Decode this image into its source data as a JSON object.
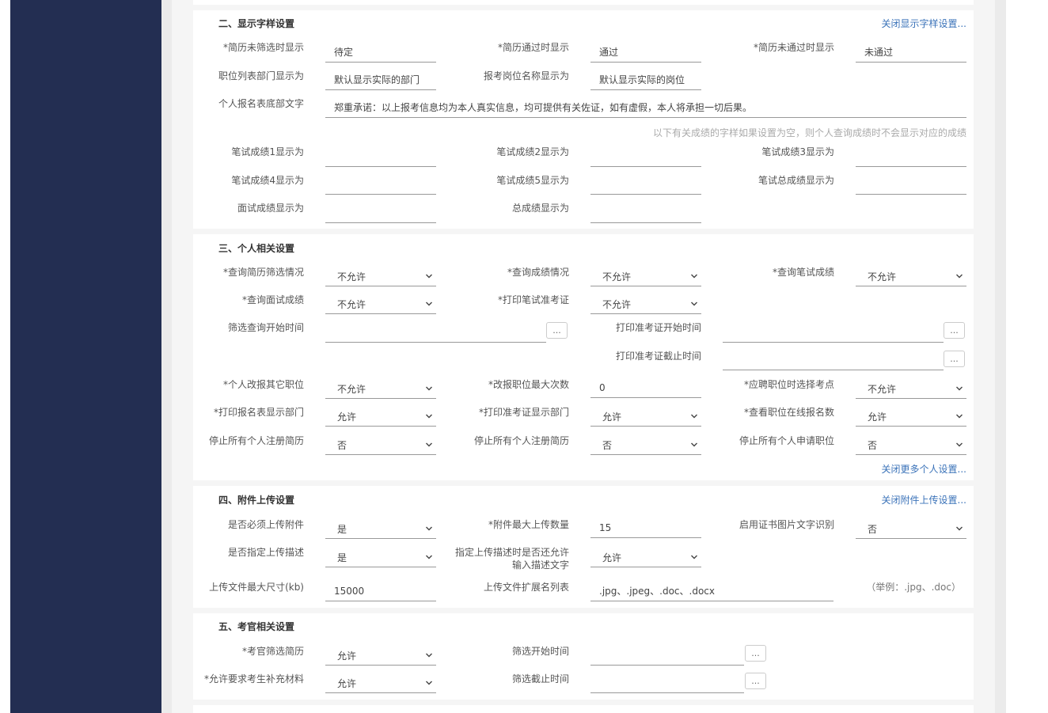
{
  "display": {
    "title": "二、显示字样设置",
    "close_link": "关闭显示字样设置...",
    "labels": {
      "unscreened": "*简历未筛选时显示",
      "passed": "*简历通过时显示",
      "failed": "*简历未通过时显示",
      "dept_list": "职位列表部门显示为",
      "position_name": "报考岗位名称显示为",
      "footer_text": "个人报名表底部文字",
      "w1": "笔试成绩1显示为",
      "w2": "笔试成绩2显示为",
      "w3": "笔试成绩3显示为",
      "w4": "笔试成绩4显示为",
      "w5": "笔试成绩5显示为",
      "wtotal": "笔试总成绩显示为",
      "interview": "面试成绩显示为",
      "total": "总成绩显示为"
    },
    "values": {
      "unscreened": "待定",
      "passed": "通过",
      "failed": "未通过",
      "dept_list": "默认显示实际的部门",
      "position_name": "默认显示实际的岗位",
      "footer_text": "郑重承诺：以上报考信息均为本人真实信息，均可提供有关佐证，如有虚假，本人将承担一切后果。"
    },
    "score_hint": "以下有关成绩的字样如果设置为空，则个人查询成绩时不会显示对应的成绩"
  },
  "personal": {
    "title": "三、个人相关设置",
    "more_link": "关闭更多个人设置...",
    "labels": {
      "q_resume": "*查询简历筛选情况",
      "q_score": "*查询成绩情况",
      "q_written": "*查询笔试成绩",
      "q_interview": "*查询面试成绩",
      "print_ticket": "*打印笔试准考证",
      "screen_query_start": "筛选查询开始时间",
      "ticket_start": "打印准考证开始时间",
      "ticket_end": "打印准考证截止时间",
      "change_other": "*个人改报其它职位",
      "change_max": "*改报职位最大次数",
      "choose_site": "*应聘职位时选择考点",
      "print_form_dept": "*打印报名表显示部门",
      "print_ticket_dept": "*打印准考证显示部门",
      "view_online": "*查看职位在线报名数",
      "stop_register_1": "停止所有个人注册简历",
      "stop_register_2": "停止所有个人注册简历",
      "stop_apply": "停止所有个人申请职位"
    },
    "values": {
      "q_resume": "不允许",
      "q_score": "不允许",
      "q_written": "不允许",
      "q_interview": "不允许",
      "print_ticket": "不允许",
      "change_other": "不允许",
      "change_max": "0",
      "choose_site": "不允许",
      "print_form_dept": "允许",
      "print_ticket_dept": "允许",
      "view_online": "允许",
      "stop_register_1": "否",
      "stop_register_2": "否",
      "stop_apply": "否"
    },
    "picker_label": "..."
  },
  "attachment": {
    "title": "四、附件上传设置",
    "close_link": "关闭附件上传设置...",
    "labels": {
      "required": "是否必须上传附件",
      "max_count": "*附件最大上传数量",
      "ocr": "启用证书图片文字识别",
      "specify_desc": "是否指定上传描述",
      "allow_input": "指定上传描述时是否还允许输入描述文字",
      "max_size": "上传文件最大尺寸(kb)",
      "ext_list": "上传文件扩展名列表"
    },
    "values": {
      "required": "是",
      "max_count": "15",
      "ocr": "否",
      "specify_desc": "是",
      "allow_input": "允许",
      "max_size": "15000",
      "ext_list": ".jpg、.jpeg、.doc、.docx"
    },
    "ext_example": "（举例：.jpg、.doc）"
  },
  "examiner": {
    "title": "五、考官相关设置",
    "labels": {
      "screen_resume": "*考官筛选简历",
      "screen_start": "筛选开始时间",
      "require_material": "*允许要求考生补充材料",
      "screen_end": "筛选截止时间"
    },
    "values": {
      "screen_resume": "允许",
      "require_material": "允许"
    }
  }
}
